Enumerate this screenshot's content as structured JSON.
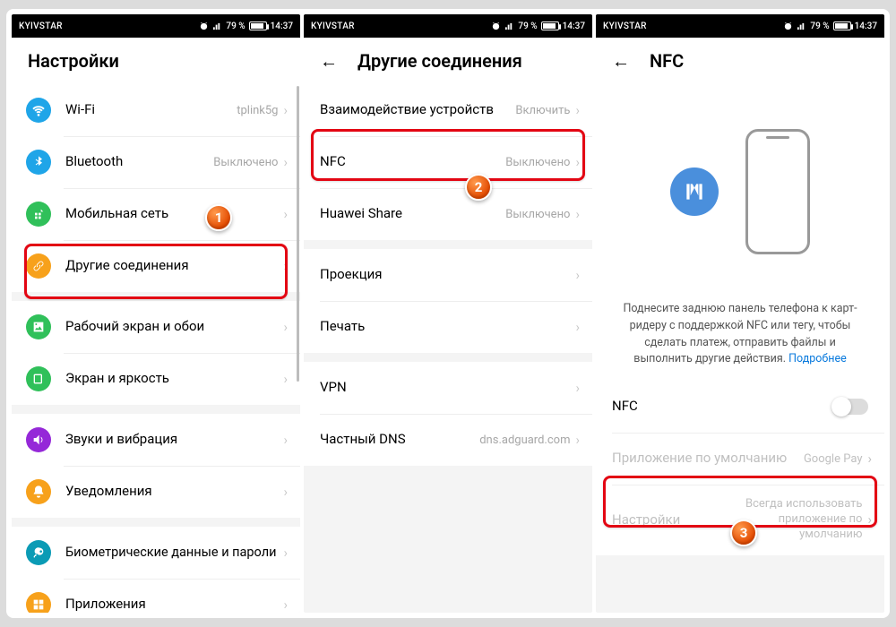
{
  "status": {
    "carrier": "KYIVSTAR",
    "batt": "79 %",
    "time": "14:37"
  },
  "screen1": {
    "title": "Настройки",
    "items": [
      {
        "label": "Wi-Fi",
        "value": "tplink5g",
        "color": "#1fa5e8",
        "icon": "wifi"
      },
      {
        "label": "Bluetooth",
        "value": "Выключено",
        "color": "#1fa5e8",
        "icon": "bt"
      },
      {
        "label": "Мобильная сеть",
        "value": "",
        "color": "#30c05a",
        "icon": "sim"
      },
      {
        "label": "Другие соединения",
        "value": "",
        "color": "#f7a11b",
        "icon": "link"
      },
      {
        "label": "Рабочий экран и обои",
        "value": "",
        "color": "#30c05a",
        "icon": "image"
      },
      {
        "label": "Экран и яркость",
        "value": "",
        "color": "#30c05a",
        "icon": "brightness"
      },
      {
        "label": "Звуки и вибрация",
        "value": "",
        "color": "#9528d8",
        "icon": "sound"
      },
      {
        "label": "Уведомления",
        "value": "",
        "color": "#f7a11b",
        "icon": "bell"
      },
      {
        "label": "Биометрические данные и пароли",
        "value": "",
        "color": "#0b9bb5",
        "icon": "key"
      },
      {
        "label": "Приложения",
        "value": "",
        "color": "#f7a11b",
        "icon": "apps"
      }
    ]
  },
  "screen2": {
    "title": "Другие соединения",
    "group1": [
      {
        "label": "Взаимодействие устройств",
        "value": "Включить"
      },
      {
        "label": "NFC",
        "value": "Выключено"
      },
      {
        "label": "Huawei Share",
        "value": "Выключено"
      }
    ],
    "group2": [
      {
        "label": "Проекция",
        "value": ""
      },
      {
        "label": "Печать",
        "value": ""
      }
    ],
    "group3": [
      {
        "label": "VPN",
        "value": ""
      },
      {
        "label": "Частный DNS",
        "value": "dns.adguard.com"
      }
    ]
  },
  "screen3": {
    "title": "NFC",
    "desc": "Поднесите заднюю панель телефона к карт-ридеру с поддержкой NFC или тегу, чтобы сделать платеж, отправить файлы и выполнить другие действия.",
    "more": "Подробнее",
    "rows": {
      "nfc": "NFC",
      "default_app_label": "Приложение по умолчанию",
      "default_app_value": "Google Pay",
      "settings_label": "Настройки",
      "settings_value": "Всегда использовать приложение по умолчанию"
    }
  }
}
